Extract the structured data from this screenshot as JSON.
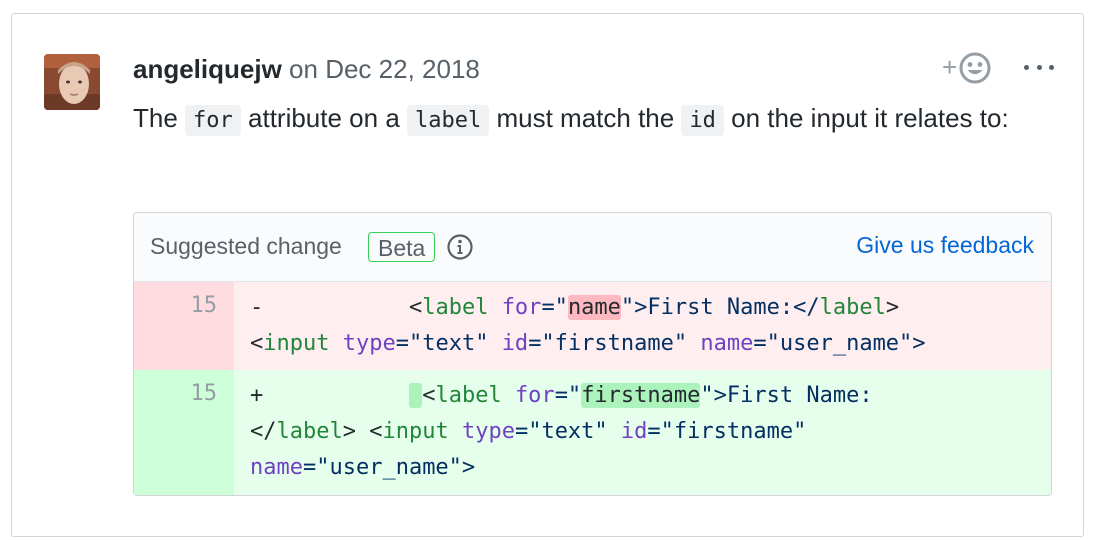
{
  "comment": {
    "author": "angeliquejw",
    "date": "on Dec 22, 2018",
    "body": {
      "t1": "The ",
      "c1": "for",
      "t2": " attribute on a ",
      "c2": "label",
      "t3": " must match the ",
      "c3": "id",
      "t4": " on the input it relates to:"
    },
    "actions": {
      "reaction_plus": "+",
      "reaction_icon": "smiley-icon",
      "more_icon": "kebab-horizontal-icon"
    }
  },
  "suggestion": {
    "title": "Suggested change",
    "badge": "Beta",
    "info_icon": "info-icon",
    "feedback_link": "Give us feedback",
    "removed": {
      "line_number": "15",
      "sign": "-",
      "indent": "           ",
      "tok": [
        "<",
        "label",
        " ",
        "for",
        "=\"",
        "name",
        "\">First Name:</",
        "label",
        ">",
        "<",
        "input",
        " ",
        "type",
        "=\"text\" ",
        "id",
        "=\"firstname\" ",
        "name",
        "=\"user_name\">"
      ]
    },
    "added": {
      "line_number": "15",
      "sign": "+",
      "indent": "           ",
      "tok": [
        "<",
        "label",
        " ",
        "for",
        "=\"",
        "firstname",
        "\">First Name:",
        "</",
        "label",
        "> <",
        "input",
        " ",
        "type",
        "=\"text\" ",
        "id",
        "=\"firstname\"",
        "name",
        "=\"user_name\">"
      ]
    },
    "colors": {
      "removed_bg": "#ffeef0",
      "removed_highlight": "#fdb8c0",
      "added_bg": "#e6ffed",
      "added_highlight": "#acf2bd",
      "link": "#0366d6",
      "tag": "#22863a",
      "attribute": "#6f42c1"
    }
  }
}
